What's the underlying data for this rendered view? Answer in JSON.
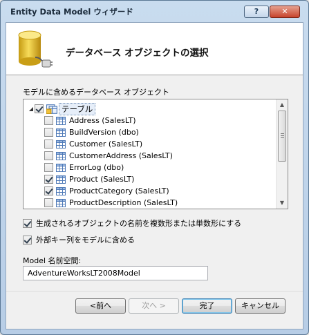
{
  "window": {
    "title": "Entity Data Model ウィザード",
    "help_label": "?",
    "close_label": "✕"
  },
  "header": {
    "title": "データベース オブジェクトの選択",
    "icon": "database-plug-icon"
  },
  "objects": {
    "group_label": "モデルに含めるデータベース オブジェクト",
    "root": {
      "label": "テーブル",
      "checked": true,
      "expander": "◢"
    },
    "items": [
      {
        "label": "Address (SalesLT)",
        "checked": false
      },
      {
        "label": "BuildVersion (dbo)",
        "checked": false
      },
      {
        "label": "Customer (SalesLT)",
        "checked": false
      },
      {
        "label": "CustomerAddress (SalesLT)",
        "checked": false
      },
      {
        "label": "ErrorLog (dbo)",
        "checked": false
      },
      {
        "label": "Product (SalesLT)",
        "checked": true
      },
      {
        "label": "ProductCategory (SalesLT)",
        "checked": true
      },
      {
        "label": "ProductDescription (SalesLT)",
        "checked": false
      }
    ],
    "scroll_up": "▲",
    "scroll_down": "▼"
  },
  "options": {
    "pluralize": {
      "label": "生成されるオブジェクトの名前を複数形または単数形にする",
      "checked": true
    },
    "foreign_keys": {
      "label": "外部キー列をモデルに含める",
      "checked": true
    }
  },
  "namespace": {
    "label": "Model 名前空間:",
    "value": "AdventureWorksLT2008Model"
  },
  "buttons": {
    "prev": "<前へ",
    "next": "次へ >",
    "finish": "完了",
    "cancel": "キャンセル"
  },
  "colors": {
    "title_gradient_top": "#c9dcef",
    "close_red": "#c7442c",
    "selection_bg": "#e6eef9"
  }
}
